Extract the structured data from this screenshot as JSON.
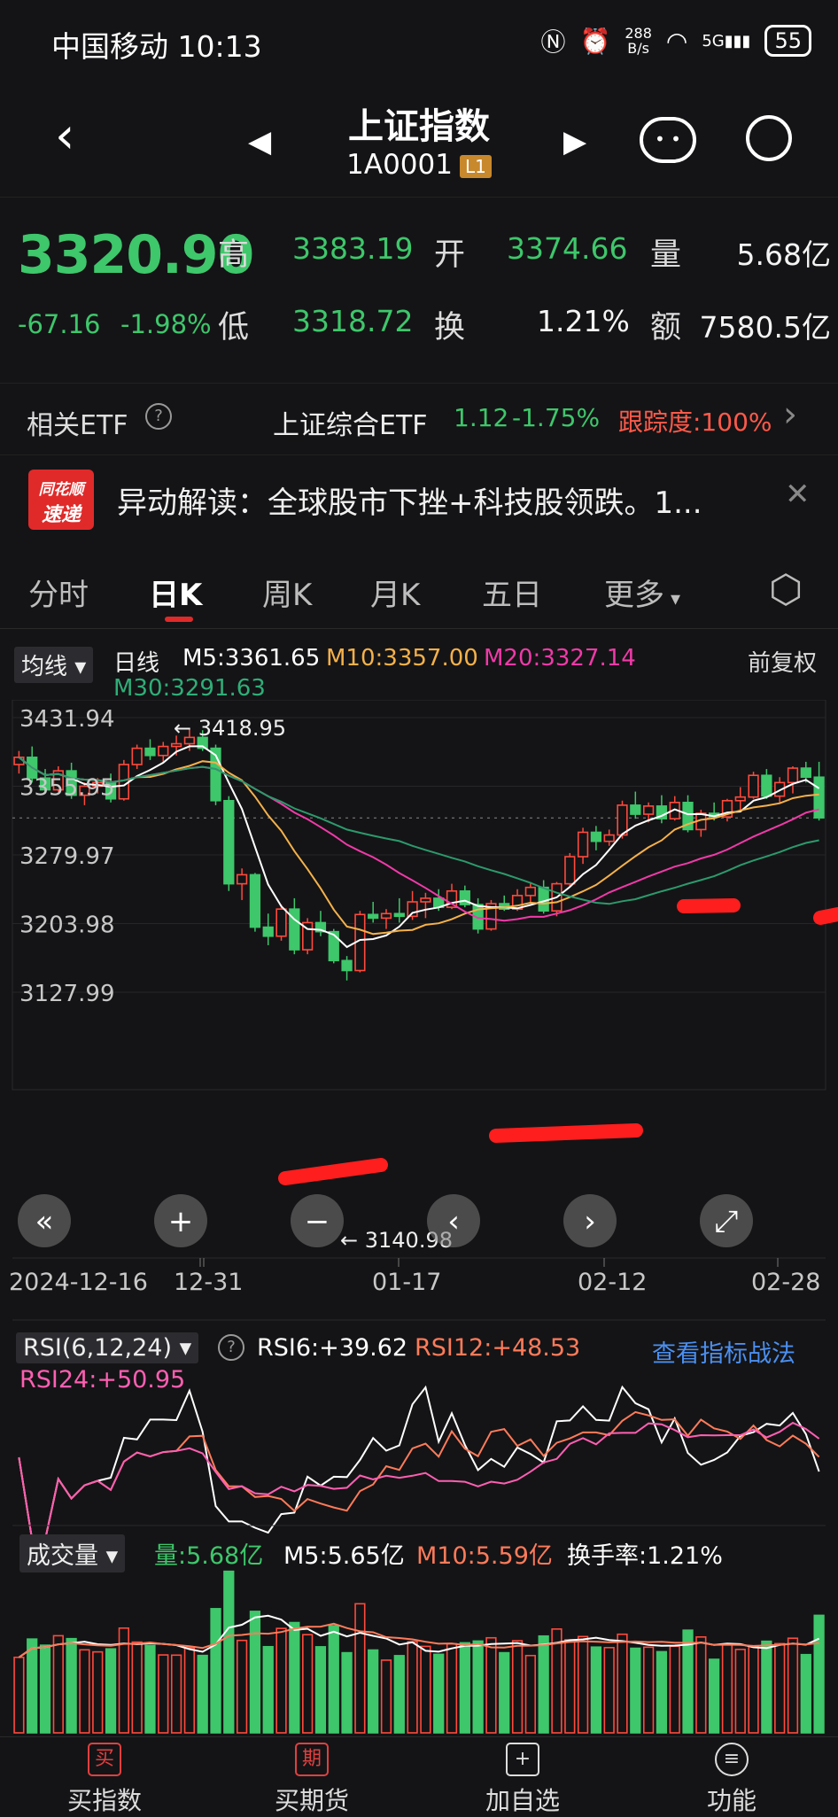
{
  "status": {
    "carrier": "中国移动",
    "time": "10:13",
    "net_speed_top": "288",
    "net_speed_unit": "B/s",
    "signal": "5G",
    "battery": "55"
  },
  "header": {
    "title": "上证指数",
    "code": "1A0001",
    "level_tag": "L1"
  },
  "quote": {
    "price": "3320.90",
    "change": "-67.16",
    "change_pct": "-1.98%",
    "high_label": "高",
    "high": "3383.19",
    "open_label": "开",
    "open": "3374.66",
    "volume_label": "量",
    "volume": "5.68亿",
    "low_label": "低",
    "low": "3318.72",
    "turnover_label": "换",
    "turnover": "1.21%",
    "amount_label": "额",
    "amount": "7580.5亿"
  },
  "etf": {
    "label": "相关ETF",
    "name": "上证综合ETF",
    "price": "1.12",
    "pct": "-1.75%",
    "tracking": "跟踪度:100%"
  },
  "news": {
    "badge_top": "同花顺",
    "badge_bottom": "速递",
    "text": "异动解读：全球股市下挫+科技股领跌。1..."
  },
  "tabs": [
    "分时",
    "日K",
    "周K",
    "月K",
    "五日",
    "更多"
  ],
  "ma": {
    "selector": "均线",
    "period": "日线",
    "ma5": "M5:3361.65",
    "ma10": "M10:3357.00",
    "ma20": "M20:3327.14",
    "ma30": "M30:3291.63",
    "adjust": "前复权"
  },
  "kline": {
    "y_labels": [
      "3431.94",
      "3355.95",
      "3279.97",
      "3203.98",
      "3127.99"
    ],
    "max_marker": "3418.95",
    "min_marker": "3140.98",
    "dates": [
      "2024-12-16",
      "12-31",
      "01-17",
      "02-12",
      "02-28"
    ]
  },
  "rsi": {
    "selector": "RSI(6,12,24)",
    "rsi6": "RSI6:+39.62",
    "rsi12": "RSI12:+48.53",
    "rsi24": "RSI24:+50.95",
    "link": "查看指标战法"
  },
  "vol": {
    "selector": "成交量",
    "vol": "量:5.68亿",
    "m5": "M5:5.65亿",
    "m10": "M10:5.59亿",
    "turnover": "换手率:1.21%"
  },
  "bottom_nav": [
    {
      "icon": "买",
      "label": "买指数"
    },
    {
      "icon": "期",
      "label": "买期货"
    },
    {
      "icon": "+",
      "label": "加自选"
    },
    {
      "icon": "≡",
      "label": "功能"
    }
  ],
  "colors": {
    "up": "#ff4a3d",
    "down": "#3ec76b",
    "ma5": "#ffffff",
    "ma10": "#f5b14a",
    "ma20": "#f03aa8",
    "ma30": "#2c9a6c",
    "link": "#4b8ff0"
  },
  "chart_data": {
    "type": "candlestick",
    "candles": [
      {
        "o": 3380,
        "h": 3395,
        "l": 3370,
        "c": 3388
      },
      {
        "o": 3388,
        "h": 3400,
        "l": 3360,
        "c": 3365
      },
      {
        "o": 3365,
        "h": 3375,
        "l": 3348,
        "c": 3352
      },
      {
        "o": 3352,
        "h": 3378,
        "l": 3350,
        "c": 3373
      },
      {
        "o": 3373,
        "h": 3382,
        "l": 3342,
        "c": 3346
      },
      {
        "o": 3346,
        "h": 3360,
        "l": 3335,
        "c": 3356
      },
      {
        "o": 3356,
        "h": 3365,
        "l": 3348,
        "c": 3360
      },
      {
        "o": 3360,
        "h": 3370,
        "l": 3338,
        "c": 3342
      },
      {
        "o": 3342,
        "h": 3385,
        "l": 3340,
        "c": 3380
      },
      {
        "o": 3380,
        "h": 3402,
        "l": 3375,
        "c": 3398
      },
      {
        "o": 3398,
        "h": 3408,
        "l": 3385,
        "c": 3390
      },
      {
        "o": 3390,
        "h": 3405,
        "l": 3383,
        "c": 3400
      },
      {
        "o": 3400,
        "h": 3412,
        "l": 3390,
        "c": 3403
      },
      {
        "o": 3403,
        "h": 3419,
        "l": 3395,
        "c": 3410
      },
      {
        "o": 3410,
        "h": 3418,
        "l": 3395,
        "c": 3398
      },
      {
        "o": 3398,
        "h": 3402,
        "l": 3335,
        "c": 3340
      },
      {
        "o": 3340,
        "h": 3345,
        "l": 3240,
        "c": 3248
      },
      {
        "o": 3248,
        "h": 3265,
        "l": 3230,
        "c": 3258
      },
      {
        "o": 3258,
        "h": 3260,
        "l": 3195,
        "c": 3200
      },
      {
        "o": 3200,
        "h": 3215,
        "l": 3180,
        "c": 3190
      },
      {
        "o": 3190,
        "h": 3225,
        "l": 3185,
        "c": 3220
      },
      {
        "o": 3220,
        "h": 3232,
        "l": 3170,
        "c": 3175
      },
      {
        "o": 3175,
        "h": 3210,
        "l": 3170,
        "c": 3205
      },
      {
        "o": 3205,
        "h": 3218,
        "l": 3190,
        "c": 3195
      },
      {
        "o": 3195,
        "h": 3198,
        "l": 3160,
        "c": 3163
      },
      {
        "o": 3163,
        "h": 3168,
        "l": 3141,
        "c": 3152
      },
      {
        "o": 3152,
        "h": 3218,
        "l": 3150,
        "c": 3214
      },
      {
        "o": 3214,
        "h": 3228,
        "l": 3205,
        "c": 3210
      },
      {
        "o": 3210,
        "h": 3220,
        "l": 3198,
        "c": 3215
      },
      {
        "o": 3215,
        "h": 3232,
        "l": 3205,
        "c": 3212
      },
      {
        "o": 3212,
        "h": 3240,
        "l": 3208,
        "c": 3228
      },
      {
        "o": 3228,
        "h": 3238,
        "l": 3210,
        "c": 3232
      },
      {
        "o": 3232,
        "h": 3242,
        "l": 3218,
        "c": 3222
      },
      {
        "o": 3222,
        "h": 3248,
        "l": 3220,
        "c": 3240
      },
      {
        "o": 3240,
        "h": 3246,
        "l": 3222,
        "c": 3225
      },
      {
        "o": 3225,
        "h": 3232,
        "l": 3193,
        "c": 3198
      },
      {
        "o": 3198,
        "h": 3230,
        "l": 3196,
        "c": 3226
      },
      {
        "o": 3226,
        "h": 3235,
        "l": 3218,
        "c": 3220
      },
      {
        "o": 3220,
        "h": 3242,
        "l": 3218,
        "c": 3235
      },
      {
        "o": 3235,
        "h": 3250,
        "l": 3228,
        "c": 3244
      },
      {
        "o": 3244,
        "h": 3252,
        "l": 3215,
        "c": 3218
      },
      {
        "o": 3218,
        "h": 3250,
        "l": 3212,
        "c": 3248
      },
      {
        "o": 3248,
        "h": 3282,
        "l": 3245,
        "c": 3278
      },
      {
        "o": 3278,
        "h": 3310,
        "l": 3270,
        "c": 3305
      },
      {
        "o": 3305,
        "h": 3312,
        "l": 3285,
        "c": 3295
      },
      {
        "o": 3295,
        "h": 3308,
        "l": 3290,
        "c": 3302
      },
      {
        "o": 3302,
        "h": 3340,
        "l": 3298,
        "c": 3335
      },
      {
        "o": 3335,
        "h": 3350,
        "l": 3320,
        "c": 3325
      },
      {
        "o": 3325,
        "h": 3338,
        "l": 3316,
        "c": 3334
      },
      {
        "o": 3334,
        "h": 3346,
        "l": 3315,
        "c": 3320
      },
      {
        "o": 3320,
        "h": 3345,
        "l": 3318,
        "c": 3338
      },
      {
        "o": 3338,
        "h": 3346,
        "l": 3305,
        "c": 3308
      },
      {
        "o": 3308,
        "h": 3330,
        "l": 3300,
        "c": 3326
      },
      {
        "o": 3326,
        "h": 3338,
        "l": 3318,
        "c": 3322
      },
      {
        "o": 3322,
        "h": 3342,
        "l": 3317,
        "c": 3340
      },
      {
        "o": 3340,
        "h": 3355,
        "l": 3330,
        "c": 3344
      },
      {
        "o": 3344,
        "h": 3372,
        "l": 3342,
        "c": 3368
      },
      {
        "o": 3368,
        "h": 3375,
        "l": 3342,
        "c": 3345
      },
      {
        "o": 3345,
        "h": 3366,
        "l": 3338,
        "c": 3360
      },
      {
        "o": 3360,
        "h": 3378,
        "l": 3348,
        "c": 3376
      },
      {
        "o": 3376,
        "h": 3383,
        "l": 3360,
        "c": 3366
      },
      {
        "o": 3366,
        "h": 3383,
        "l": 3318,
        "c": 3321
      }
    ],
    "ylim": [
      3127.99,
      3431.94
    ]
  }
}
